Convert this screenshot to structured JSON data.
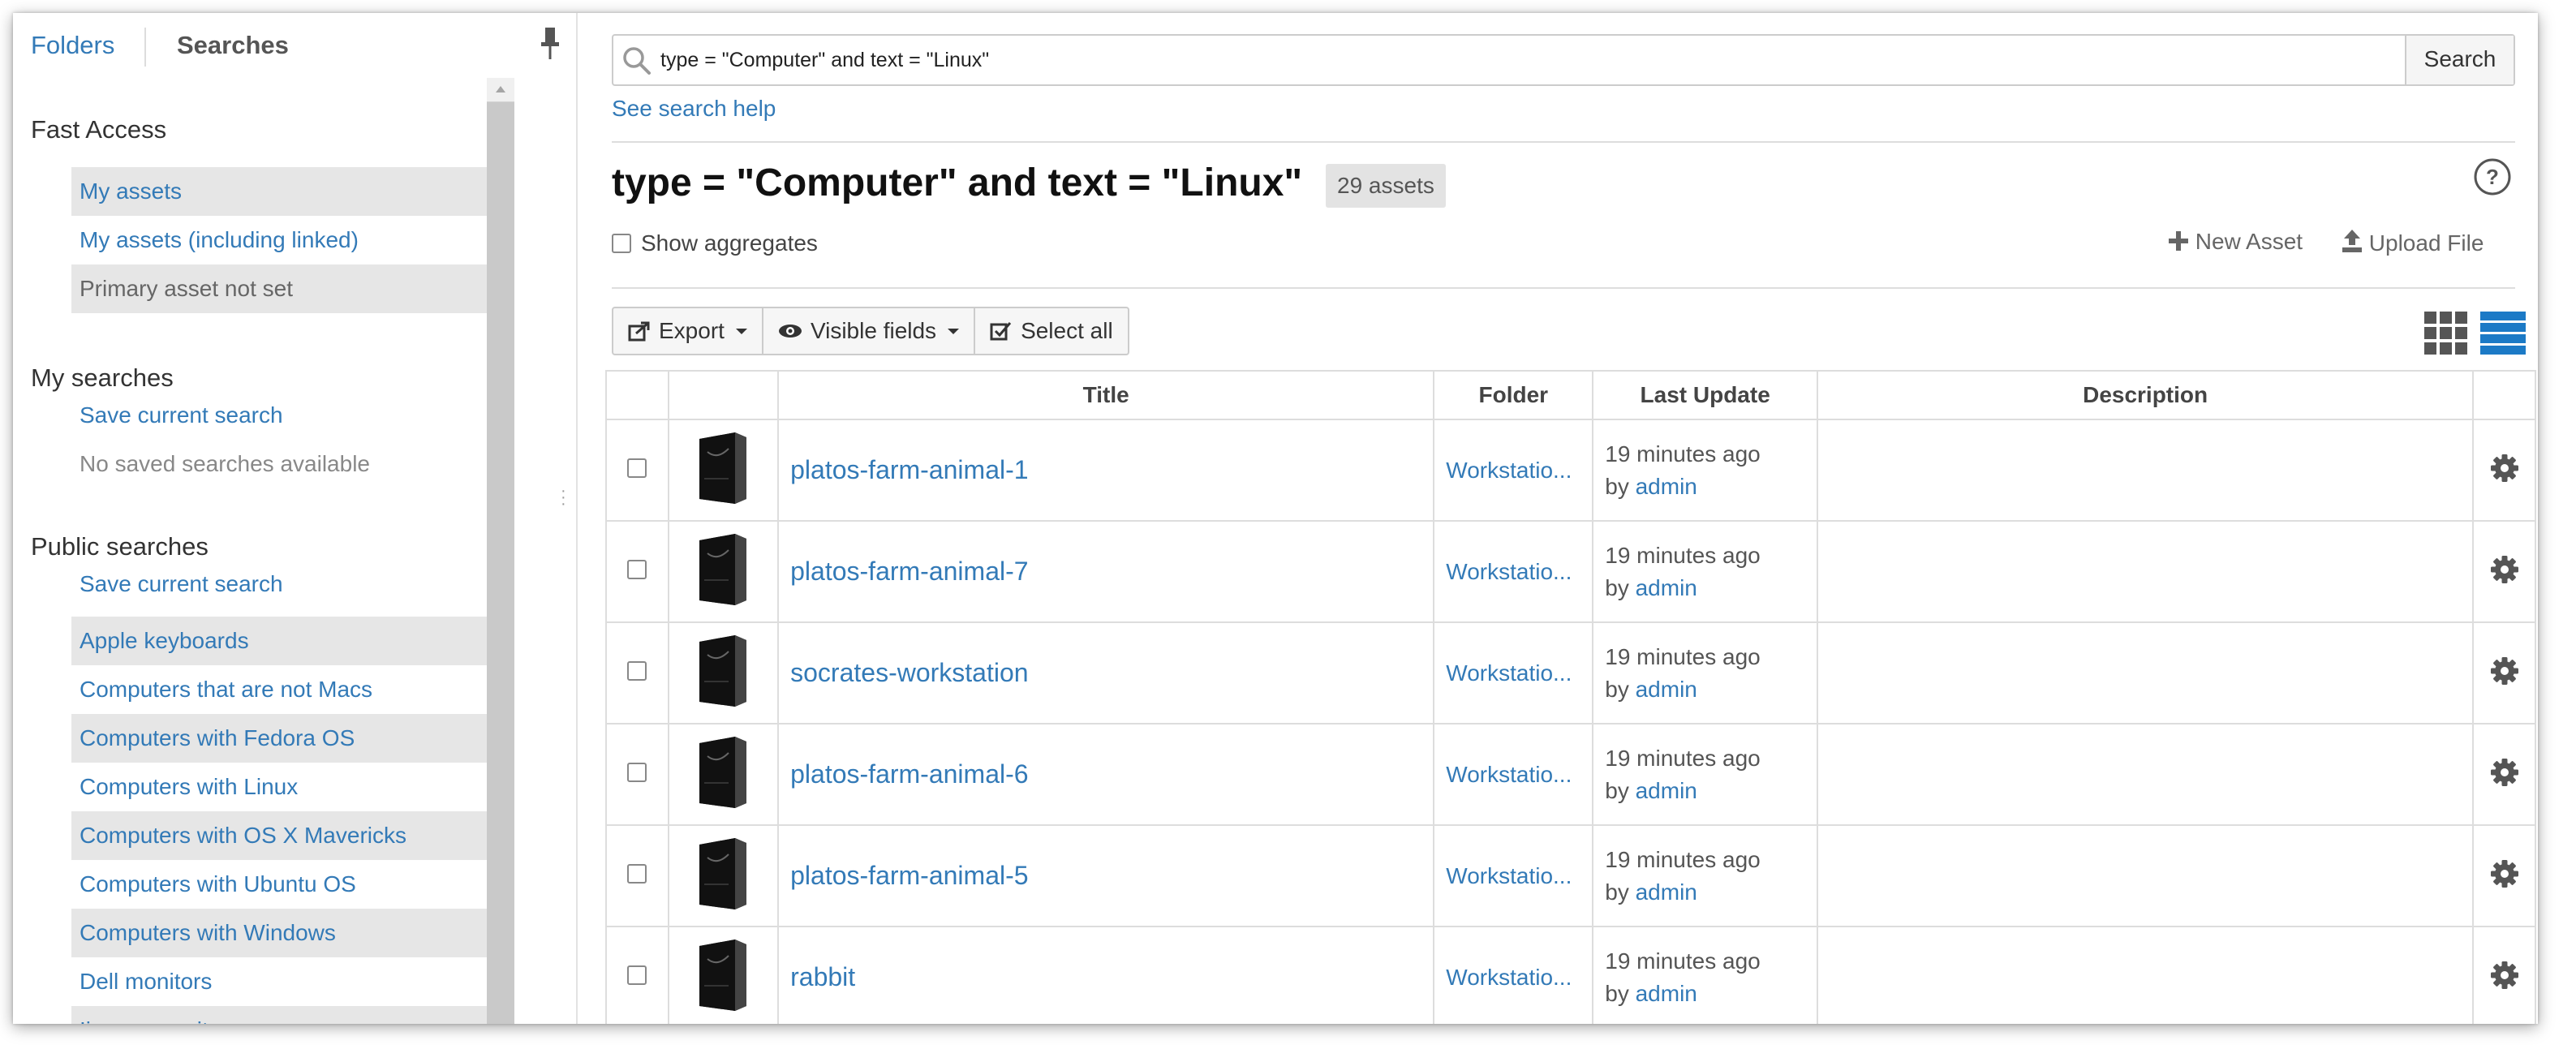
{
  "sidebar": {
    "tabs": {
      "folders": "Folders",
      "searches": "Searches"
    },
    "fast_access": {
      "heading": "Fast Access",
      "items": [
        "My assets",
        "My assets (including linked)",
        "Primary asset not set"
      ]
    },
    "my_searches": {
      "heading": "My searches",
      "save_link": "Save current search",
      "empty_text": "No saved searches available"
    },
    "public_searches": {
      "heading": "Public searches",
      "save_link": "Save current search",
      "items": [
        "Apple keyboards",
        "Computers that are not Macs",
        "Computers with Fedora OS",
        "Computers with Linux",
        "Computers with OS X Mavericks",
        "Computers with Ubuntu OS",
        "Computers with Windows",
        "Dell monitors",
        "Iiyama monitors"
      ]
    }
  },
  "search": {
    "query": "type = \"Computer\" and text = \"Linux\"",
    "button": "Search",
    "help_link": "See search help"
  },
  "results": {
    "title": "type = \"Computer\" and text = \"Linux\"",
    "count": "29 assets",
    "show_aggregates": "Show aggregates",
    "new_asset": "New Asset",
    "upload_file": "Upload File"
  },
  "toolbar": {
    "export": "Export",
    "visible_fields": "Visible fields",
    "select_all": "Select all"
  },
  "table": {
    "columns": {
      "title": "Title",
      "folder": "Folder",
      "last_update": "Last Update",
      "description": "Description"
    },
    "rows": [
      {
        "title": "platos-farm-animal-1",
        "folder": "Workstatio...",
        "updated": "19 minutes ago",
        "by_prefix": "by",
        "by_user": "admin",
        "description": ""
      },
      {
        "title": "platos-farm-animal-7",
        "folder": "Workstatio...",
        "updated": "19 minutes ago",
        "by_prefix": "by",
        "by_user": "admin",
        "description": ""
      },
      {
        "title": "socrates-workstation",
        "folder": "Workstatio...",
        "updated": "19 minutes ago",
        "by_prefix": "by",
        "by_user": "admin",
        "description": ""
      },
      {
        "title": "platos-farm-animal-6",
        "folder": "Workstatio...",
        "updated": "19 minutes ago",
        "by_prefix": "by",
        "by_user": "admin",
        "description": ""
      },
      {
        "title": "platos-farm-animal-5",
        "folder": "Workstatio...",
        "updated": "19 minutes ago",
        "by_prefix": "by",
        "by_user": "admin",
        "description": ""
      },
      {
        "title": "rabbit",
        "folder": "Workstatio...",
        "updated": "19 minutes ago",
        "by_prefix": "by",
        "by_user": "admin",
        "description": ""
      }
    ]
  },
  "colors": {
    "link": "#337ab7",
    "active_view": "#1c7ac6",
    "shade": "#e6e6e6"
  },
  "icons": [
    "pin-icon",
    "search-icon",
    "help-icon",
    "plus-icon",
    "upload-icon",
    "export-icon",
    "eye-icon",
    "checkbox-icon",
    "grid-view-icon",
    "list-view-icon",
    "computer-tower-icon",
    "gear-icon"
  ]
}
